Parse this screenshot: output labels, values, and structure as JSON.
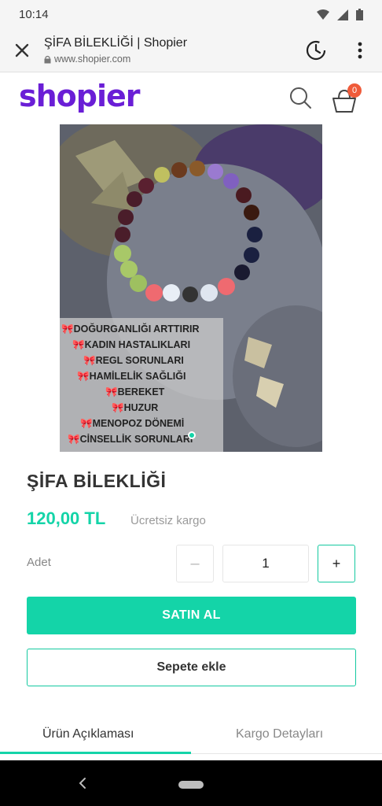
{
  "status_bar": {
    "time": "10:14"
  },
  "browser": {
    "title": "ŞİFA BİLEKLİĞİ | Shopier",
    "url": "www.shopier.com"
  },
  "site": {
    "logo": "shopier",
    "cart_count": "0"
  },
  "image_caption": {
    "lines": [
      "🎀DOĞURGANLIĞI ARTTIRIR",
      "🎀KADIN HASTALIKLARI",
      "🎀REGL SORUNLARI",
      "🎀HAMİLELİK SAĞLIĞI",
      "🎀BEREKET",
      "🎀HUZUR",
      "🎀MENOPOZ DÖNEMİ",
      "🎀CİNSELLİK SORUNLARI"
    ]
  },
  "product": {
    "name": "ŞİFA BİLEKLİĞİ",
    "price": "120,00 TL",
    "shipping": "Ücretsiz kargo",
    "qty_label": "Adet",
    "qty_minus": "–",
    "qty_value": "1",
    "qty_plus": "+",
    "buy_label": "SATIN AL",
    "add_to_cart_label": "Sepete ekle"
  },
  "tabs": [
    {
      "label": "Ürün Açıklaması"
    },
    {
      "label": "Kargo Detayları"
    }
  ],
  "colors": {
    "brand": "#6a1ed6",
    "accent": "#14d4a8",
    "badge": "#ef5b3a"
  }
}
